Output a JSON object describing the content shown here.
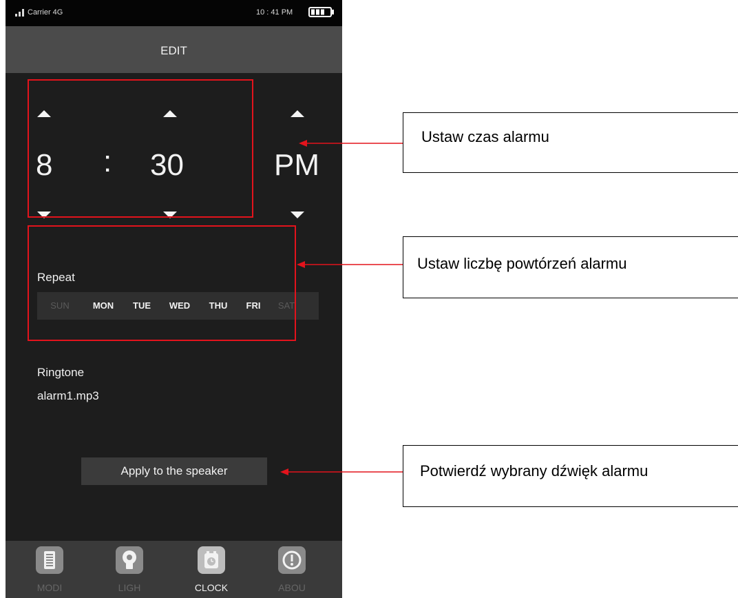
{
  "status_bar": {
    "carrier": "Carrier  4G",
    "time": "10 : 41 PM"
  },
  "header": {
    "title": "EDIT"
  },
  "time_picker": {
    "hour": "8",
    "separator": ":",
    "minute": "30",
    "period": "PM"
  },
  "repeat": {
    "label": "Repeat",
    "days": [
      {
        "label": "SUN",
        "selected": false
      },
      {
        "label": "MON",
        "selected": true
      },
      {
        "label": "TUE",
        "selected": true
      },
      {
        "label": "WED",
        "selected": true
      },
      {
        "label": "THU",
        "selected": true
      },
      {
        "label": "FRI",
        "selected": true
      },
      {
        "label": "SAT",
        "selected": false
      }
    ]
  },
  "ringtone": {
    "label": "Ringtone",
    "file": "alarm1.mp3"
  },
  "apply_button": {
    "label": "Apply to the speaker"
  },
  "tab_bar": {
    "tabs": [
      {
        "label": "MODI",
        "icon": "mode-icon",
        "active": false
      },
      {
        "label": "LIGH",
        "icon": "bulb-icon",
        "active": false
      },
      {
        "label": "CLOCK",
        "icon": "clock-icon",
        "active": true
      },
      {
        "label": "ABOU",
        "icon": "info-icon",
        "active": false
      }
    ]
  },
  "annotations": {
    "set_time": "Ustaw czas alarmu",
    "set_repeat": "Ustaw liczbę powtórzeń alarmu",
    "confirm_sound": "Potwierdź wybrany dźwięk alarmu"
  },
  "colors": {
    "annotation": "#e3131c",
    "screen_bg": "#1d1d1d",
    "header_bg": "#4b4b4b"
  }
}
